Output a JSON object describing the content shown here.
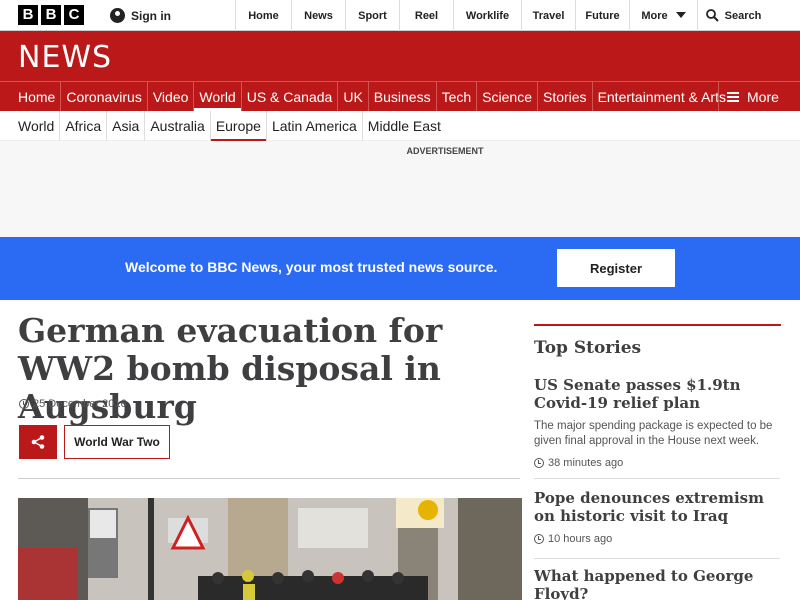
{
  "brand": {
    "letters": [
      "B",
      "B",
      "C"
    ],
    "color": "#bb1919",
    "accent_blue": "#2b6bf3"
  },
  "account": {
    "signin_label": "Sign in"
  },
  "top_nav": [
    {
      "label": "Home"
    },
    {
      "label": "News"
    },
    {
      "label": "Sport"
    },
    {
      "label": "Reel"
    },
    {
      "label": "Worklife"
    },
    {
      "label": "Travel"
    },
    {
      "label": "Future"
    },
    {
      "label": "More"
    },
    {
      "label": "Search"
    }
  ],
  "news_title": "NEWS",
  "section_nav": [
    {
      "label": "Home"
    },
    {
      "label": "Coronavirus"
    },
    {
      "label": "Video"
    },
    {
      "label": "World"
    },
    {
      "label": "US & Canada"
    },
    {
      "label": "UK"
    },
    {
      "label": "Business"
    },
    {
      "label": "Tech"
    },
    {
      "label": "Science"
    },
    {
      "label": "Stories"
    },
    {
      "label": "Entertainment & Arts"
    }
  ],
  "section_more": "More",
  "sub_nav": [
    {
      "label": "World"
    },
    {
      "label": "Africa"
    },
    {
      "label": "Asia"
    },
    {
      "label": "Australia"
    },
    {
      "label": "Europe"
    },
    {
      "label": "Latin America"
    },
    {
      "label": "Middle East"
    }
  ],
  "ad": {
    "label": "ADVERTISEMENT"
  },
  "welcome": {
    "text": "Welcome to BBC News, your most trusted news source.",
    "register_label": "Register"
  },
  "article": {
    "headline": "German evacuation for WW2 bomb disposal in Augsburg",
    "date": "25 December 2016",
    "tag": "World War Two"
  },
  "top_stories": {
    "title": "Top Stories",
    "items": [
      {
        "headline": "US Senate passes $1.9tn Covid-19 relief plan",
        "summary": "The major spending package is expected to be given final approval in the House next week.",
        "time": "38 minutes ago"
      },
      {
        "headline": "Pope denounces extremism on historic visit to Iraq",
        "summary": "",
        "time": "10 hours ago"
      },
      {
        "headline": "What happened to George Floyd?",
        "summary": "",
        "time": ""
      }
    ]
  }
}
